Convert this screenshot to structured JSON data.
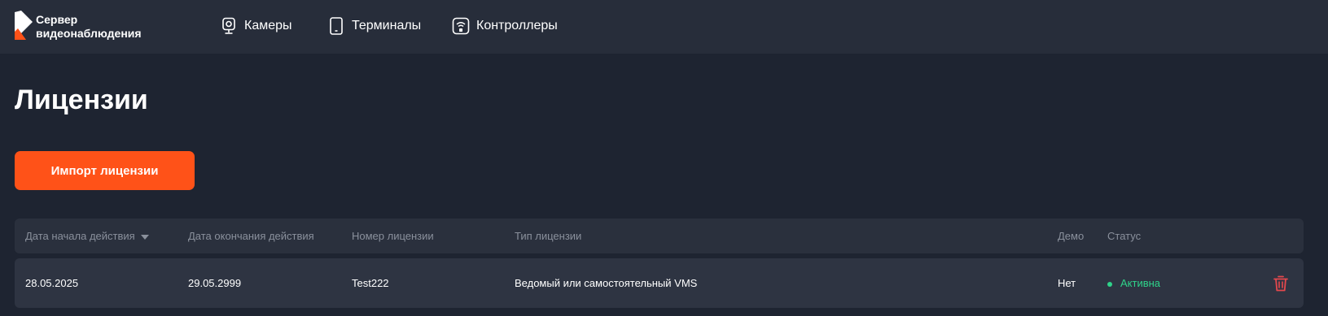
{
  "header": {
    "logo_line1": "Сервер",
    "logo_line2": "видеонаблюдения",
    "nav": [
      {
        "label": "Камеры",
        "icon": "camera-icon"
      },
      {
        "label": "Терминалы",
        "icon": "tablet-icon"
      },
      {
        "label": "Контроллеры",
        "icon": "wifi-controller-icon"
      }
    ]
  },
  "page": {
    "title": "Лицензии",
    "import_button": "Импорт лицензии"
  },
  "table": {
    "columns": [
      "Дата начала действия",
      "Дата окончания действия",
      "Номер лицензии",
      "Тип лицензии",
      "Демо",
      "Статус"
    ],
    "sort_icon": "sort-down-icon",
    "rows": [
      {
        "start": "28.05.2025",
        "end": "29.05.2999",
        "number": "Test222",
        "type": "Ведомый или самостоятельный VMS",
        "demo": "Нет",
        "status": "Активна"
      }
    ]
  },
  "colors": {
    "background": "#1e2431",
    "header": "#272d3a",
    "accent": "#ff5218",
    "status_active": "#2fd38a",
    "delete": "#e5484d"
  }
}
